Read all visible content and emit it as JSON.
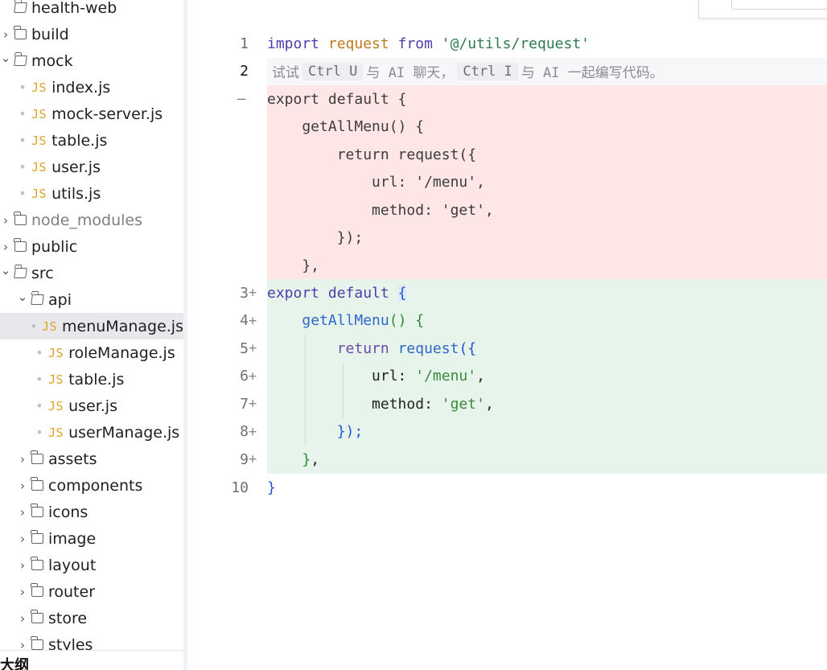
{
  "sidebar": {
    "items": [
      {
        "label": "health-web",
        "kind": "folder-open",
        "depth": 0,
        "chevron": "none"
      },
      {
        "label": "build",
        "kind": "folder",
        "depth": 0,
        "chevron": "right"
      },
      {
        "label": "mock",
        "kind": "folder-open",
        "depth": 0,
        "chevron": "down"
      },
      {
        "label": "index.js",
        "kind": "js",
        "depth": 1
      },
      {
        "label": "mock-server.js",
        "kind": "js",
        "depth": 1
      },
      {
        "label": "table.js",
        "kind": "js",
        "depth": 1
      },
      {
        "label": "user.js",
        "kind": "js",
        "depth": 1
      },
      {
        "label": "utils.js",
        "kind": "js",
        "depth": 1
      },
      {
        "label": "node_modules",
        "kind": "folder",
        "depth": 0,
        "chevron": "right",
        "muted": true
      },
      {
        "label": "public",
        "kind": "folder",
        "depth": 0,
        "chevron": "right"
      },
      {
        "label": "src",
        "kind": "folder-open",
        "depth": 0,
        "chevron": "down"
      },
      {
        "label": "api",
        "kind": "folder-open",
        "depth": 1,
        "chevron": "down"
      },
      {
        "label": "menuManage.js",
        "kind": "js",
        "depth": 2,
        "selected": true
      },
      {
        "label": "roleManage.js",
        "kind": "js",
        "depth": 2
      },
      {
        "label": "table.js",
        "kind": "js",
        "depth": 2
      },
      {
        "label": "user.js",
        "kind": "js",
        "depth": 2
      },
      {
        "label": "userManage.js",
        "kind": "js",
        "depth": 2
      },
      {
        "label": "assets",
        "kind": "folder",
        "depth": 1,
        "chevron": "right"
      },
      {
        "label": "components",
        "kind": "folder",
        "depth": 1,
        "chevron": "right"
      },
      {
        "label": "icons",
        "kind": "folder",
        "depth": 1,
        "chevron": "right"
      },
      {
        "label": "image",
        "kind": "folder",
        "depth": 1,
        "chevron": "right"
      },
      {
        "label": "layout",
        "kind": "folder",
        "depth": 1,
        "chevron": "right"
      },
      {
        "label": "router",
        "kind": "folder",
        "depth": 1,
        "chevron": "right"
      },
      {
        "label": "store",
        "kind": "folder",
        "depth": 1,
        "chevron": "right"
      },
      {
        "label": "styles",
        "kind": "folder",
        "depth": 1,
        "chevron": "right"
      }
    ],
    "js_badge": "JS",
    "outline_label": "大纲"
  },
  "editor": {
    "line1": {
      "num": "1",
      "t1": "import",
      "t2": "request",
      "t3": "from",
      "t4": "'@/utils/request'"
    },
    "line2": {
      "num": "2",
      "h1": "试试",
      "k1": "Ctrl U",
      "h2": "与 AI 聊天，",
      "k2": "Ctrl I",
      "h3": "与 AI 一起编写代码。"
    },
    "deleted_marker": "—",
    "deleted": [
      "export default {",
      "    getAllMenu() {",
      "        return request({",
      "            url: '/menu',",
      "            method: 'get',",
      "        });",
      "    },"
    ],
    "added_marker": "+",
    "line3": {
      "num": "3",
      "a": "export",
      "b": "default",
      "c": "{"
    },
    "line4": {
      "num": "4",
      "a": "getAllMenu",
      "b": "()",
      "c": "{"
    },
    "line5": {
      "num": "5",
      "a": "return",
      "b": "request",
      "c": "(",
      "d": "{"
    },
    "line6": {
      "num": "6",
      "a": "url:",
      "b": "'/menu'",
      "c": ","
    },
    "line7": {
      "num": "7",
      "a": "method:",
      "b": "'get'",
      "c": ","
    },
    "line8": {
      "num": "8",
      "a": "}",
      "b": ");"
    },
    "line9": {
      "num": "9",
      "a": "}",
      "b": ","
    },
    "line10": {
      "num": "10",
      "a": "}"
    }
  },
  "colors": {
    "deleted_bg": "#fde6e5",
    "added_bg": "#e7f4ec",
    "selected_row": "#e7e8ec",
    "js_icon": "#e0a325"
  }
}
